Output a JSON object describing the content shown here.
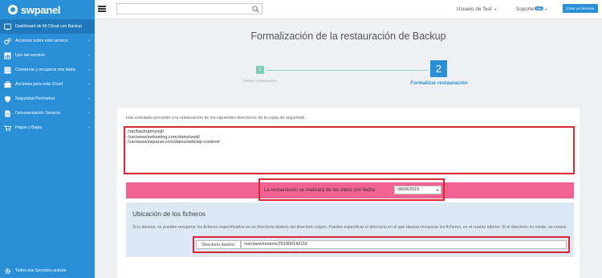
{
  "brand": {
    "name": "swpanel"
  },
  "sidebar": {
    "items": [
      {
        "label": "Dashboard de Mi Cloud con Backup",
        "icon": "dashboard-icon",
        "chevron": false
      },
      {
        "label": "Acciones sobre este servicio",
        "icon": "gears-icon",
        "chevron": true
      },
      {
        "label": "Uso del servicio",
        "icon": "chart-icon",
        "chevron": true
      },
      {
        "label": "Conservar y recuperar mis datos",
        "icon": "database-icon",
        "chevron": true
      },
      {
        "label": "Acciones para este Cloud",
        "icon": "briefcase-icon",
        "chevron": true
      },
      {
        "label": "Seguridad Perimetral",
        "icon": "shield-icon",
        "chevron": true
      },
      {
        "label": "Documentación Servicio",
        "icon": "document-icon",
        "chevron": true
      },
      {
        "label": "Pagos y Bajas",
        "icon": "cart-icon",
        "chevron": true
      }
    ],
    "footer": "Todos mis Servicios activos"
  },
  "topbar": {
    "search_placeholder": "",
    "user": "Usuario de Test",
    "support": "Soporte",
    "support_badge": "SW",
    "create_button": "Crear un Servicio"
  },
  "page": {
    "title": "Formalización de la restauración de Backup",
    "steps": [
      {
        "number": "1",
        "label": "Definir restauración"
      },
      {
        "number": "2",
        "label": "Formalizar restauración"
      }
    ]
  },
  "form": {
    "intro": "Has solicitado proceder a la restauración de los siguientes directorios de la copia de seguridad.",
    "directories": [
      "/var/backupmysql/",
      "/var/www/swhosting.com/datos/web/",
      "/var/www/swpanel.com/datos/web/wp-content/"
    ],
    "date_label": "La restauración se realizará de los datos con fecha",
    "date_value": "08/06/2019",
    "location_title": "Ubicación de los ficheros",
    "location_desc": "Si lo deseas, se pueden recuperar los ficheros especificados en un directorio distinto del directorio origen. Puedes especificar el directorio en el que deseas recuperar los ficheros, en el cuadro inferior. Si el directorio no existe, se creará.",
    "dest_label": "Directorio destino",
    "dest_value": "/var/www/restore/201906142116"
  },
  "colors": {
    "sidebar": "#2a8fd6",
    "accent": "#2a8fd6",
    "pink": "#f26394",
    "highlight": "#d9262f",
    "step_done": "#7fcfb8"
  }
}
